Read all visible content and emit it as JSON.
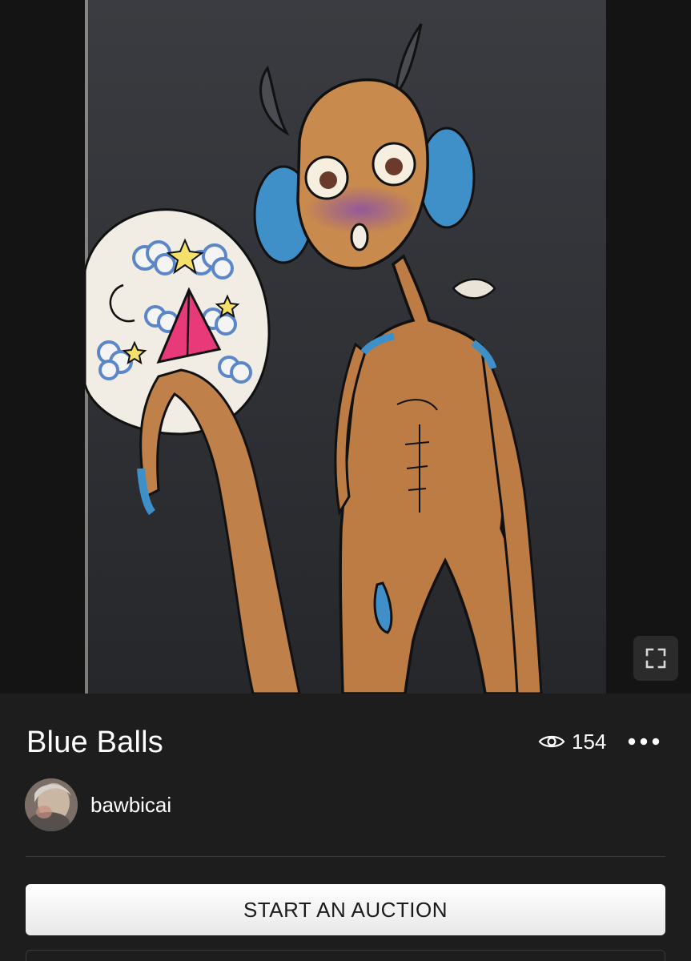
{
  "artwork": {
    "title": "Blue Balls",
    "views": "154",
    "icons": {
      "views": "eye-icon",
      "more": "more-dots-icon",
      "fullscreen": "fullscreen-icon"
    }
  },
  "creator": {
    "username": "bawbicai"
  },
  "actions": {
    "start_auction_label": "START AN AUCTION"
  },
  "colors": {
    "background": "#1d1d1d",
    "button": "#ffffff",
    "button_text": "#1b1b1b",
    "divider": "#3a3a3a"
  }
}
